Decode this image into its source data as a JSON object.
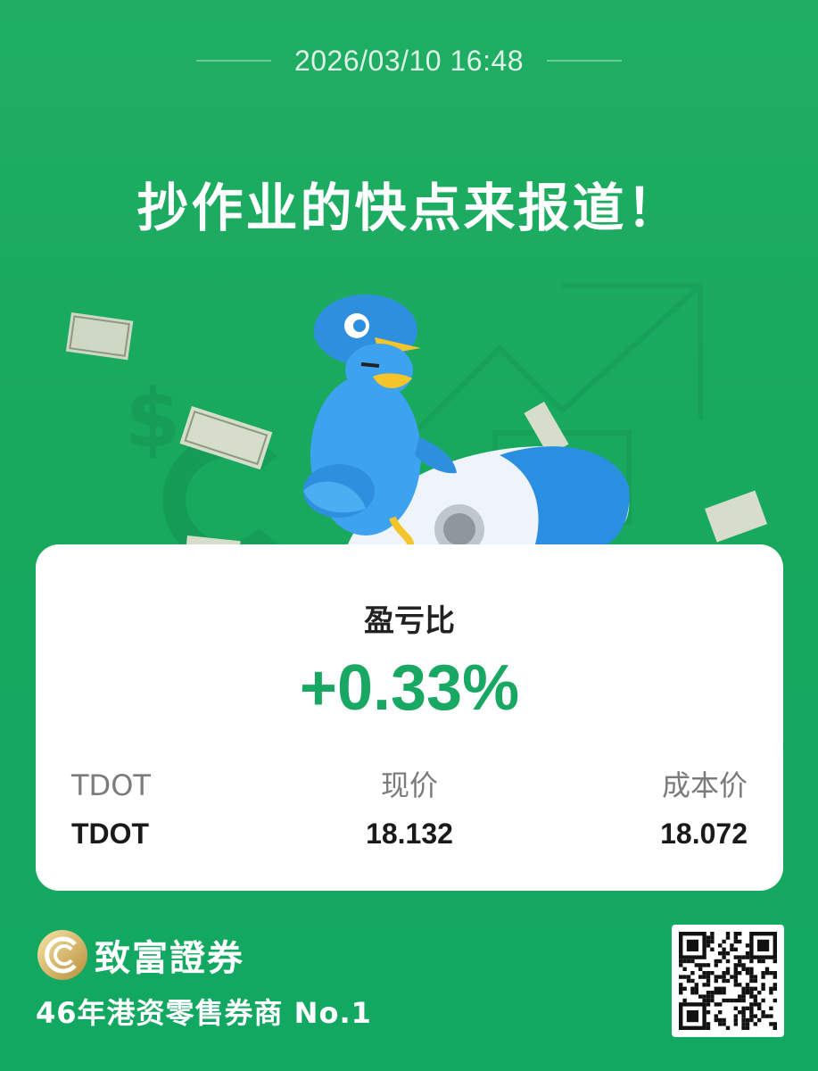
{
  "header": {
    "datetime": "2026/03/10 16:48",
    "headline": "抄作业的快点来报道！"
  },
  "card": {
    "label": "盈亏比",
    "value": "+0.33%",
    "columns": {
      "symbol_header": "TDOT",
      "symbol_value": "TDOT",
      "price_header": "现价",
      "price_value": "18.132",
      "cost_header": "成本价",
      "cost_value": "18.072"
    }
  },
  "footer": {
    "brand_name": "致富證券",
    "slogan": "46年港资零售券商 No.1"
  },
  "icons": {
    "mascot": "pigeon-mascot-riding-rocket",
    "brand_logo": "chief-logo",
    "qr": "qr-code"
  },
  "colors": {
    "background": "#18a85e",
    "accent_green": "#19a863",
    "card": "#ffffff"
  }
}
